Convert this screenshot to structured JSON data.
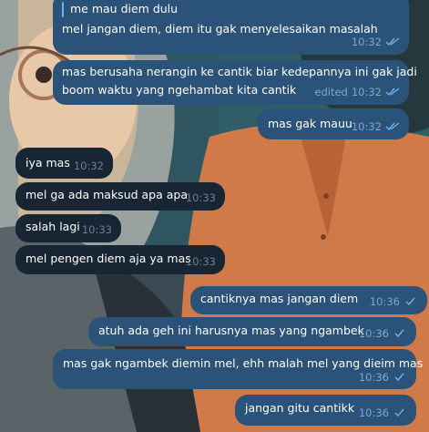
{
  "messages": [
    {
      "id": "m1",
      "side": "out",
      "reply_quote": "me mau diem dulu",
      "text": "mel jangan diem, diem itu gak menyelesaikan masalah",
      "time": "10:32",
      "edited": "",
      "read": true
    },
    {
      "id": "m2",
      "side": "out",
      "lines": [
        "mas berusaha nerangin ke cantik biar kedepannya ini gak jadi",
        "boom waktu yang ngehambat kita cantik"
      ],
      "time": "10:32",
      "edited": "edited",
      "read": true
    },
    {
      "id": "m3",
      "side": "out",
      "text": "mas gak mauu",
      "time": "10:32",
      "edited": "",
      "read": true
    },
    {
      "id": "m4",
      "side": "in",
      "text": "iya mas",
      "time": "10:32"
    },
    {
      "id": "m5",
      "side": "in",
      "text": "mel ga ada maksud apa apa",
      "time": "10:33"
    },
    {
      "id": "m6",
      "side": "in",
      "text": "salah lagi",
      "time": "10:33"
    },
    {
      "id": "m7",
      "side": "in",
      "text": "mel pengen diem aja ya mas",
      "time": "10:33"
    },
    {
      "id": "m8",
      "side": "out",
      "text": "cantiknya mas jangan diem",
      "time": "10:36",
      "read": false
    },
    {
      "id": "m9",
      "side": "out",
      "text": "atuh ada geh ini harusnya mas yang ngambek",
      "time": "10:36",
      "read": false
    },
    {
      "id": "m10",
      "side": "out",
      "text": "mas gak ngambek diemin mel, ehh malah mel yang dieim mas",
      "time": "10:36",
      "read": false
    },
    {
      "id": "m11",
      "side": "out",
      "text": "jangan gitu cantikk",
      "time": "10:36",
      "read": false
    }
  ],
  "colors": {
    "outgoing_bubble": "#2b5278",
    "incoming_bubble": "#182533",
    "tick": "#6ab3f3"
  }
}
